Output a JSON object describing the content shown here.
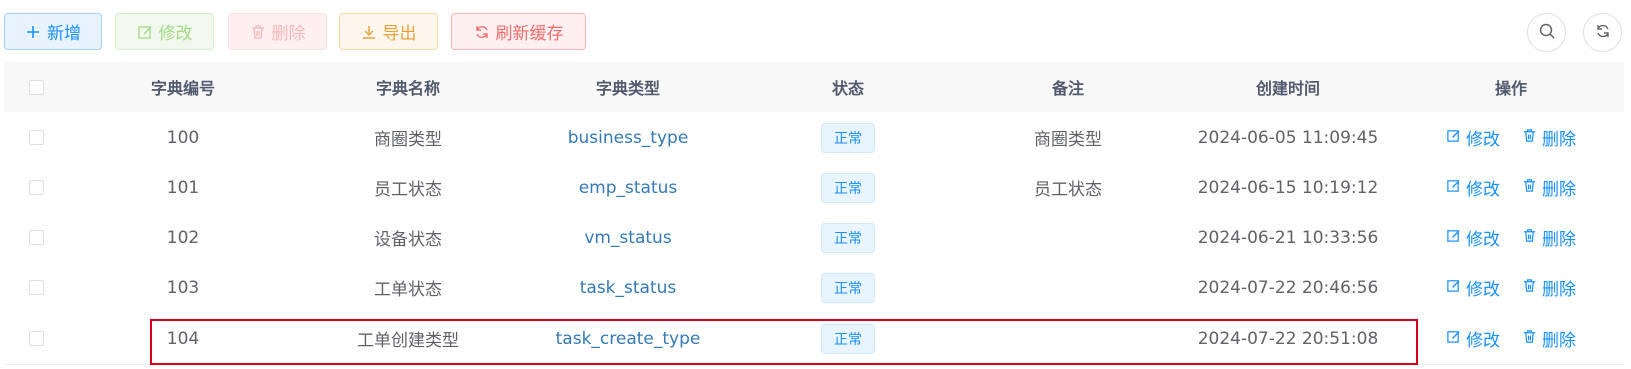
{
  "toolbar": {
    "add_label": "新增",
    "edit_label": "修改",
    "delete_label": "删除",
    "export_label": "导出",
    "refresh_cache_label": "刷新缓存"
  },
  "right_tools": {
    "search_icon": "search-icon",
    "refresh_icon": "refresh-icon"
  },
  "table": {
    "headers": [
      "字典编号",
      "字典名称",
      "字典类型",
      "状态",
      "备注",
      "创建时间",
      "操作"
    ],
    "rows": [
      {
        "id": "100",
        "name": "商圈类型",
        "type": "business_type",
        "status": "正常",
        "remark": "商圈类型",
        "created": "2024-06-05 11:09:45",
        "edit": "修改",
        "delete": "删除"
      },
      {
        "id": "101",
        "name": "员工状态",
        "type": "emp_status",
        "status": "正常",
        "remark": "员工状态",
        "created": "2024-06-15 10:19:12",
        "edit": "修改",
        "delete": "删除"
      },
      {
        "id": "102",
        "name": "设备状态",
        "type": "vm_status",
        "status": "正常",
        "remark": "",
        "created": "2024-06-21 10:33:56",
        "edit": "修改",
        "delete": "删除"
      },
      {
        "id": "103",
        "name": "工单状态",
        "type": "task_status",
        "status": "正常",
        "remark": "",
        "created": "2024-07-22 20:46:56",
        "edit": "修改",
        "delete": "删除"
      },
      {
        "id": "104",
        "name": "工单创建类型",
        "type": "task_create_type",
        "status": "正常",
        "remark": "",
        "created": "2024-07-22 20:51:08",
        "edit": "修改",
        "delete": "删除"
      }
    ]
  },
  "colors": {
    "primary": "#1890ff",
    "success_light": "#a5d98a",
    "danger_light": "#f7b8b8",
    "warning": "#e6a23c",
    "danger": "#f56c6c",
    "highlight_border": "#d9001b",
    "link": "#337ab7"
  }
}
